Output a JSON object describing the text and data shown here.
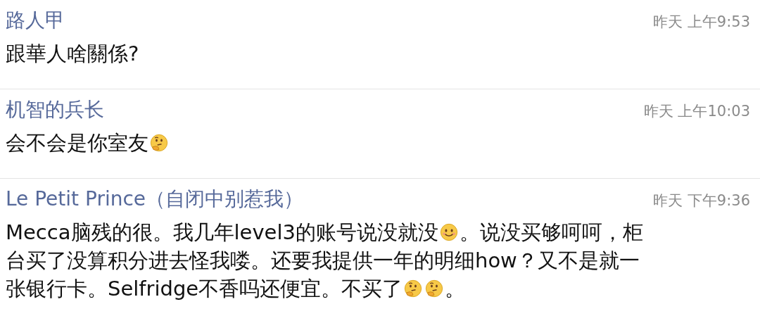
{
  "comments": [
    {
      "author": "路人甲",
      "time": "昨天 上午9:53",
      "lines": [
        [
          {
            "kind": "text",
            "text": "跟華人啥關係?"
          }
        ]
      ]
    },
    {
      "author": "机智的兵长",
      "time": "昨天 上午10:03",
      "lines": [
        [
          {
            "kind": "text",
            "text": "会不会是你室友"
          },
          {
            "kind": "thinking"
          }
        ]
      ]
    },
    {
      "author": "Le Petit Prince（自闭中别惹我）",
      "time": "昨天 下午9:36",
      "lines": [
        [
          {
            "kind": "text",
            "text": "Mecca脑残的很。我几年level3的账号说没就没"
          },
          {
            "kind": "smile"
          },
          {
            "kind": "text",
            "text": "。说没买够呵呵，柜"
          }
        ],
        [
          {
            "kind": "text",
            "text": "台买了没算积分进去怪我喽。还要我提供一年的明细how？又不是就一"
          }
        ],
        [
          {
            "kind": "text",
            "text": "张银行卡。Selfridge不香吗还便宜。不买了"
          },
          {
            "kind": "thinking"
          },
          {
            "kind": "thinking"
          },
          {
            "kind": "text",
            "text": "。"
          }
        ]
      ]
    }
  ]
}
